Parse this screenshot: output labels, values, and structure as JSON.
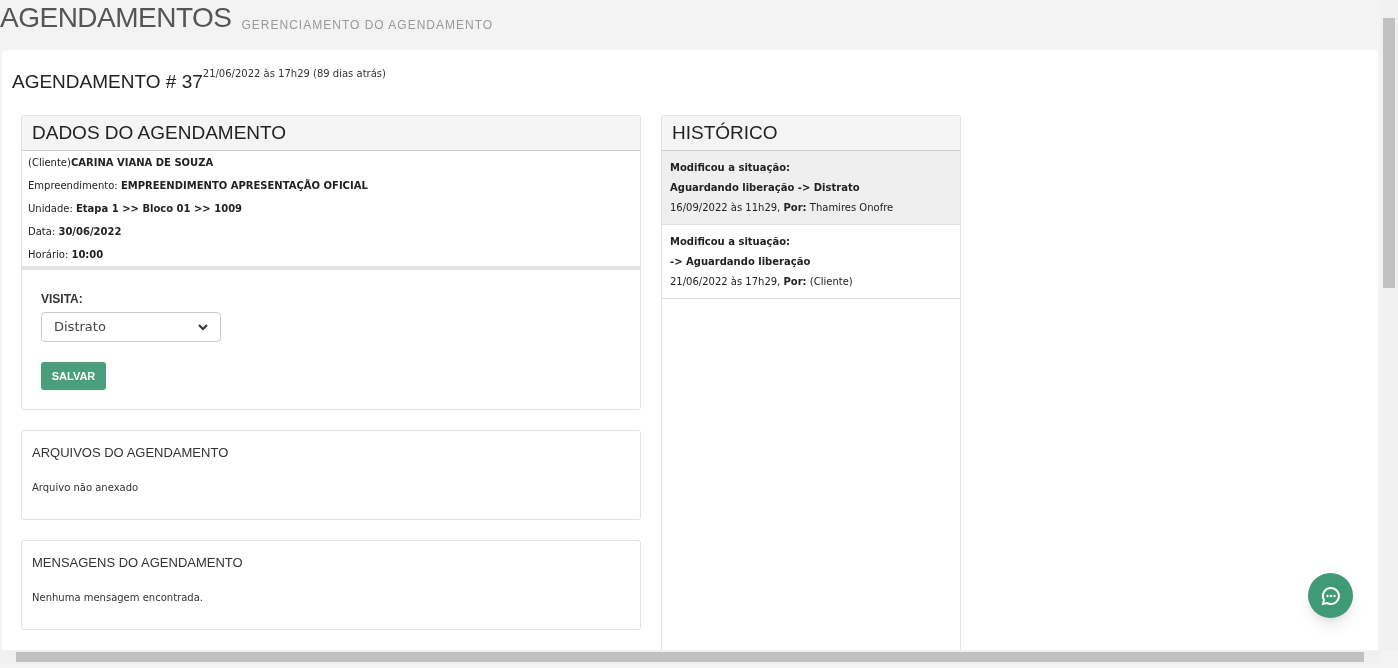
{
  "page_header": {
    "title": "AGENDAMENTOS",
    "subtitle": "GERENCIAMENTO DO AGENDAMENTO"
  },
  "booking": {
    "title": "AGENDAMENTO # 37",
    "created": "21/06/2022 às 17h29 (89 dias atrás)"
  },
  "details": {
    "title": "DADOS DO AGENDAMENTO",
    "rows": [
      "(Cliente)**CARINA VIANA DE SOUZA**",
      "Empreendimento: **EMPREENDIMENTO APRESENTAÇÃO OFICIAL**",
      "Unidade: **Etapa 1 >> Bloco 01 >> 1009**",
      "Data: **30/06/2022**",
      "Horário: **10:00**"
    ],
    "visit_label": "VISITA:",
    "visit_value": "Distrato",
    "save_button": "SALVAR"
  },
  "files": {
    "title": "ARQUIVOS DO AGENDAMENTO",
    "text": "Arquivo não anexado"
  },
  "messages": {
    "title": "MENSAGENS DO AGENDAMENTO",
    "text": "Nenhuma mensagem encontrada."
  },
  "history": {
    "title": "HISTÓRICO",
    "entries": [
      {
        "action": "Modificou a situação:",
        "change": "Aguardando liberação -> Distrato",
        "meta": "16/09/2022 às 11h29, **Por:** Thamires Onofre",
        "selected": true
      },
      {
        "action": "Modificou a situação:",
        "change": "-> Aguardando liberação",
        "meta": "21/06/2022 às 17h29, **Por:** (Cliente)",
        "selected": false
      }
    ]
  }
}
